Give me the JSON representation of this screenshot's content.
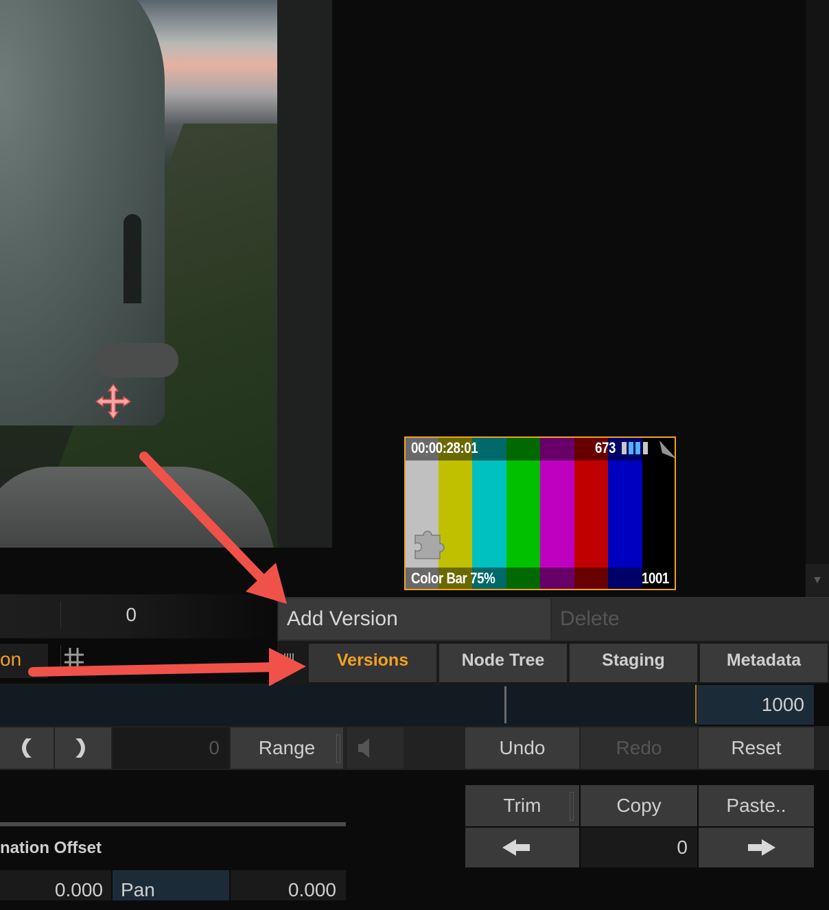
{
  "thumbnail": {
    "timecode": "00:00:28:01",
    "frame_count": "673",
    "title": "Color Bar 75%",
    "end_frame": "1001",
    "bar_colors": [
      "#c0c0c0",
      "#c0c000",
      "#00c0c0",
      "#00c000",
      "#c000c0",
      "#c00000",
      "#0000c0",
      "#000000"
    ],
    "border_color": "#f3a21e"
  },
  "left_panel": {
    "top_value": "0",
    "partial_label": "on"
  },
  "version_bar": {
    "add_version_label": "Add Version",
    "delete_label": "Delete"
  },
  "tabs": [
    {
      "label": "Versions",
      "active": true
    },
    {
      "label": "Node Tree",
      "active": false
    },
    {
      "label": "Staging",
      "active": false
    },
    {
      "label": "Metadata",
      "active": false
    }
  ],
  "timeline": {
    "frame_field": "1000"
  },
  "controls": {
    "range_value": "0",
    "range_label": "Range",
    "undo_label": "Undo",
    "redo_label": "Redo",
    "reset_label": "Reset",
    "trim_label": "Trim",
    "copy_label": "Copy",
    "paste_label": "Paste..",
    "offset_value": "0"
  },
  "animation": {
    "section_label": "nation Offset",
    "left_value": "0.000",
    "pan_label": "Pan",
    "pan_value": "0.000"
  },
  "accent_color": "#f3a21e",
  "annotation_arrow_color": "#f0524a"
}
